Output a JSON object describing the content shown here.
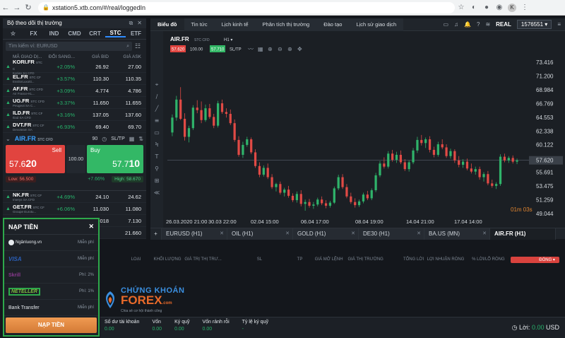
{
  "browser": {
    "url": "xstation5.xtb.com/#/real/loggedIn",
    "avatar_letter": "K"
  },
  "market_panel": {
    "title": "Bộ theo dõi thị trường",
    "tabs": [
      "☆",
      "FX",
      "IND",
      "CMD",
      "CRT",
      "STC",
      "ETF"
    ],
    "active_tab": "STC",
    "search_placeholder": "Tìm kiếm ví: EURUSD",
    "columns": {
      "symbol": "MÃ GIAO DỊ...",
      "change": "ĐỔI SANG...",
      "bid": "GIÁ BID",
      "ask": "GIÁ ASK"
    },
    "rows_top": [
      {
        "sym": "KORI.FR",
        "tag": "STC C",
        "sub": "Korian SA CFD",
        "chg": "+2.05%",
        "bid": "26.92",
        "ask": "27.00"
      },
      {
        "sym": "EL.FR",
        "tag": "STC CF",
        "sub": "EssilorLuxotti...",
        "chg": "+3.57%",
        "bid": "110.30",
        "ask": "110.35"
      },
      {
        "sym": "AF.FR",
        "tag": "STC CFD",
        "sub": "Air France-KL...",
        "chg": "+3.09%",
        "bid": "4.774",
        "ask": "4.786"
      },
      {
        "sym": "UG.FR",
        "tag": "STC CFD",
        "sub": "Peugeot SA C...",
        "chg": "+3.37%",
        "bid": "11.650",
        "ask": "11.655"
      },
      {
        "sym": "ILD.FR",
        "tag": "STC CF",
        "sub": "Iliad SA CFD",
        "chg": "+3.16%",
        "bid": "137.05",
        "ask": "137.60"
      },
      {
        "sym": "DVT.FR",
        "tag": "STC CF",
        "sub": "Devoteam SA",
        "chg": "+6.93%",
        "bid": "69.40",
        "ask": "69.70"
      }
    ],
    "trade": {
      "symbol": "AIR.FR",
      "tag": "STC CFD",
      "volume": "90",
      "sltp": "SL/TP",
      "sell_label": "Sell",
      "sell_price_small": "57.6",
      "sell_price_big": "20",
      "buy_label": "Buy",
      "buy_price_small": "57.7",
      "buy_price_big": "10",
      "mid": "100.00",
      "low": "Low: 56.500",
      "high": "High: 58.670",
      "pct": "+7.66%"
    },
    "rows_bottom": [
      {
        "sym": "NK.FR",
        "tag": "STC CF",
        "sub": "Imerys SA CFD",
        "chg": "+4.69%",
        "bid": "24.10",
        "ask": "24.62"
      },
      {
        "sym": "GET.FR",
        "tag": "STC CF",
        "sub": "Groupe Eurotu...",
        "chg": "+6.06%",
        "bid": "11.030",
        "ask": "11.080"
      },
      {
        "sym": "RXL.FR",
        "tag": "STC CF",
        "sub": "",
        "chg": "+5.47%",
        "bid": "7.018",
        "ask": "7.130"
      },
      {
        "sym": "",
        "tag": "",
        "sub": "",
        "chg": "",
        "bid": "",
        "ask": "21.660"
      }
    ]
  },
  "chart_toolbar": {
    "items": [
      "Biểu đồ",
      "Tin tức",
      "Lịch kinh tế",
      "Phân tích thị trường",
      "Đào tạo",
      "Lịch sử giao dịch"
    ],
    "mode": "REAL",
    "account": "1576551"
  },
  "chart_header": {
    "symbol": "AIR.FR",
    "tag": "STC CFD",
    "interval": "H1",
    "sell": "57.620",
    "mid": "100.00",
    "buy": "57.710",
    "sltp": "SL/TP"
  },
  "chart_data": {
    "type": "candlestick",
    "title": "AIR.FR",
    "x_tick_labels": [
      "26.03.2020 21:00",
      "30.03 22:00",
      "02.04 15:00",
      "06.04 17:00",
      "08.04 19:00",
      "14.04 21:00",
      "17.04 14:00"
    ],
    "y_tick_labels": [
      "73.416",
      "71.200",
      "68.984",
      "66.769",
      "64.553",
      "62.338",
      "60.122",
      "57.620",
      "55.691",
      "53.475",
      "51.259",
      "49.044"
    ],
    "ylim": [
      49.044,
      73.416
    ],
    "current_price": 57.62,
    "countdown": "01m 03s",
    "grid": false,
    "candles": [
      [
        62.1,
        65.0,
        61.5,
        64.5
      ],
      [
        64.5,
        68.0,
        64.0,
        67.4
      ],
      [
        67.4,
        69.4,
        64.1,
        64.3
      ],
      [
        64.3,
        65.2,
        60.8,
        61.4
      ],
      [
        61.4,
        63.2,
        60.5,
        62.8
      ],
      [
        62.8,
        66.5,
        62.5,
        66.1
      ],
      [
        66.1,
        67.3,
        65.2,
        65.7
      ],
      [
        65.7,
        67.1,
        63.6,
        64.1
      ],
      [
        64.1,
        66.6,
        63.8,
        66.0
      ],
      [
        66.0,
        66.7,
        64.3,
        64.6
      ],
      [
        64.6,
        65.1,
        62.8,
        63.2
      ],
      [
        63.2,
        67.2,
        62.9,
        66.8
      ],
      [
        66.8,
        67.4,
        65.1,
        65.4
      ],
      [
        65.4,
        66.0,
        64.5,
        65.1
      ],
      [
        65.1,
        65.8,
        63.3,
        63.6
      ],
      [
        63.6,
        64.2,
        60.6,
        60.9
      ],
      [
        60.9,
        61.5,
        58.2,
        58.5
      ],
      [
        58.5,
        60.6,
        58.0,
        60.1
      ],
      [
        60.1,
        61.4,
        59.8,
        61.0
      ],
      [
        61.0,
        61.3,
        58.6,
        58.9
      ],
      [
        58.9,
        59.4,
        56.4,
        56.7
      ],
      [
        56.7,
        57.3,
        54.9,
        55.3
      ],
      [
        55.3,
        56.8,
        55.0,
        56.4
      ],
      [
        56.4,
        57.1,
        54.6,
        54.9
      ],
      [
        54.9,
        55.4,
        53.0,
        53.3
      ],
      [
        53.3,
        54.0,
        52.6,
        53.8
      ],
      [
        53.8,
        54.2,
        52.1,
        52.4
      ],
      [
        52.4,
        53.2,
        51.8,
        52.9
      ],
      [
        52.9,
        53.5,
        51.6,
        51.9
      ],
      [
        51.9,
        52.3,
        50.9,
        51.2
      ],
      [
        51.2,
        52.6,
        50.8,
        52.2
      ],
      [
        52.2,
        52.8,
        50.2,
        50.6
      ],
      [
        50.6,
        51.3,
        49.5,
        50.9
      ],
      [
        50.9,
        51.4,
        50.0,
        50.3
      ],
      [
        50.3,
        50.9,
        49.8,
        50.5
      ],
      [
        50.5,
        51.6,
        50.2,
        51.3
      ],
      [
        51.3,
        51.8,
        50.4,
        50.7
      ],
      [
        50.7,
        51.2,
        49.9,
        50.3
      ],
      [
        50.3,
        51.1,
        50.0,
        50.8
      ],
      [
        50.8,
        53.4,
        50.6,
        53.1
      ],
      [
        53.1,
        55.3,
        52.8,
        54.9
      ],
      [
        54.9,
        55.4,
        53.0,
        53.3
      ],
      [
        53.3,
        53.8,
        51.5,
        51.8
      ],
      [
        51.8,
        52.4,
        50.6,
        50.9
      ],
      [
        50.9,
        51.5,
        50.0,
        50.4
      ],
      [
        50.4,
        51.3,
        50.1,
        51.0
      ],
      [
        51.0,
        52.4,
        50.7,
        52.1
      ],
      [
        52.1,
        52.7,
        51.2,
        51.5
      ],
      [
        51.5,
        53.1,
        51.2,
        52.8
      ],
      [
        52.8,
        55.6,
        52.5,
        55.2
      ],
      [
        55.2,
        57.5,
        54.9,
        57.1
      ],
      [
        57.1,
        58.1,
        56.3,
        56.6
      ],
      [
        56.6,
        59.1,
        56.3,
        58.7
      ],
      [
        58.7,
        59.3,
        57.4,
        57.7
      ],
      [
        57.7,
        59.0,
        57.2,
        58.5
      ],
      [
        58.5,
        59.2,
        57.0,
        57.3
      ],
      [
        57.3,
        57.8,
        55.9,
        56.2
      ],
      [
        56.2,
        57.6,
        55.8,
        57.3
      ],
      [
        57.3,
        59.6,
        57.0,
        59.2
      ],
      [
        59.2,
        61.4,
        58.8,
        60.9
      ],
      [
        60.9,
        61.7,
        60.0,
        60.4
      ],
      [
        60.4,
        61.3,
        59.6,
        61.0
      ],
      [
        61.0,
        61.5,
        58.9,
        59.3
      ],
      [
        59.3,
        59.8,
        58.1,
        58.5
      ],
      [
        58.5,
        60.6,
        58.2,
        60.2
      ],
      [
        60.2,
        61.0,
        59.4,
        59.7
      ],
      [
        59.7,
        60.2,
        58.0,
        58.3
      ],
      [
        58.3,
        59.5,
        57.9,
        59.1
      ],
      [
        59.1,
        59.4,
        57.2,
        57.6
      ],
      [
        57.6,
        58.3,
        56.5,
        56.9
      ],
      [
        56.9,
        57.8,
        56.4,
        57.4
      ],
      [
        57.4,
        57.9,
        56.0,
        56.3
      ],
      [
        56.3,
        57.1,
        55.5,
        55.8
      ],
      [
        55.8,
        56.6,
        55.3,
        56.2
      ],
      [
        56.2,
        56.6,
        54.5,
        54.9
      ],
      [
        54.9,
        55.7,
        54.2,
        55.4
      ],
      [
        55.4,
        55.9,
        53.6,
        53.9
      ],
      [
        53.9,
        54.5,
        53.2,
        53.5
      ],
      [
        53.5,
        54.1,
        53.0,
        53.8
      ],
      [
        53.8,
        58.6,
        53.5,
        58.2
      ],
      [
        58.2,
        58.7,
        57.3,
        57.6
      ],
      [
        57.6,
        58.3,
        57.2,
        58.0
      ],
      [
        58.0,
        58.4,
        57.1,
        57.4
      ],
      [
        57.4,
        57.9,
        57.0,
        57.6
      ]
    ]
  },
  "chart_tabs": [
    {
      "label": "EURUSD (H1)",
      "closable": true
    },
    {
      "label": "OIL (H1)",
      "closable": true
    },
    {
      "label": "GOLD (H1)",
      "closable": true
    },
    {
      "label": "DE30 (H1)",
      "closable": true
    },
    {
      "label": "BA.US (MN)",
      "closable": true
    },
    {
      "label": "AIR.FR (H1)",
      "closable": false
    }
  ],
  "positions_header": [
    "LOẠI",
    "KHỐI LƯỢNG",
    "GIÁ TRỊ THỊ TRƯ...",
    "SL",
    "TP",
    "GIÁ MỞ LỆNH",
    "GIÁ THỊ TRƯỜNG",
    "TỔNG LỜI",
    "LỢI NHUẬN RÒNG",
    "% LỜI/LỖ RÒNG"
  ],
  "close_button": "ĐÓNG",
  "deposit": {
    "title": "NẠP TIỀN",
    "methods": [
      {
        "name": "Ngânluong.vn",
        "fee": "Miễn phí",
        "style": "ngl"
      },
      {
        "name": "VISA",
        "fee": "Miễn phí",
        "style": "visa"
      },
      {
        "name": "Skrill",
        "fee": "Phí: 2%",
        "style": "skrill"
      },
      {
        "name": "NETELLER",
        "fee": "Phí: 1%",
        "style": "neteller"
      },
      {
        "name": "Bank Transfer",
        "fee": "Miễn phí",
        "style": "bank"
      }
    ],
    "button": "NẠP TIỀN"
  },
  "watermark": {
    "line1": "CHỨNG KHOÁN",
    "line2": "FOREX",
    "suffix": ".com",
    "slogan": "Chia sẻ cơ hội thành công"
  },
  "account_bar": [
    {
      "label": "Số dư tài khoản",
      "value": "0.00"
    },
    {
      "label": "Vốn",
      "value": "0.00"
    },
    {
      "label": "Ký quỹ",
      "value": "0.00"
    },
    {
      "label": "Vốn rảnh rỗi",
      "value": "0.00"
    },
    {
      "label": "Tỷ lệ ký quỹ",
      "value": "-"
    }
  ],
  "profit": {
    "label": "Lời:",
    "value": "0.00",
    "currency": "USD"
  }
}
